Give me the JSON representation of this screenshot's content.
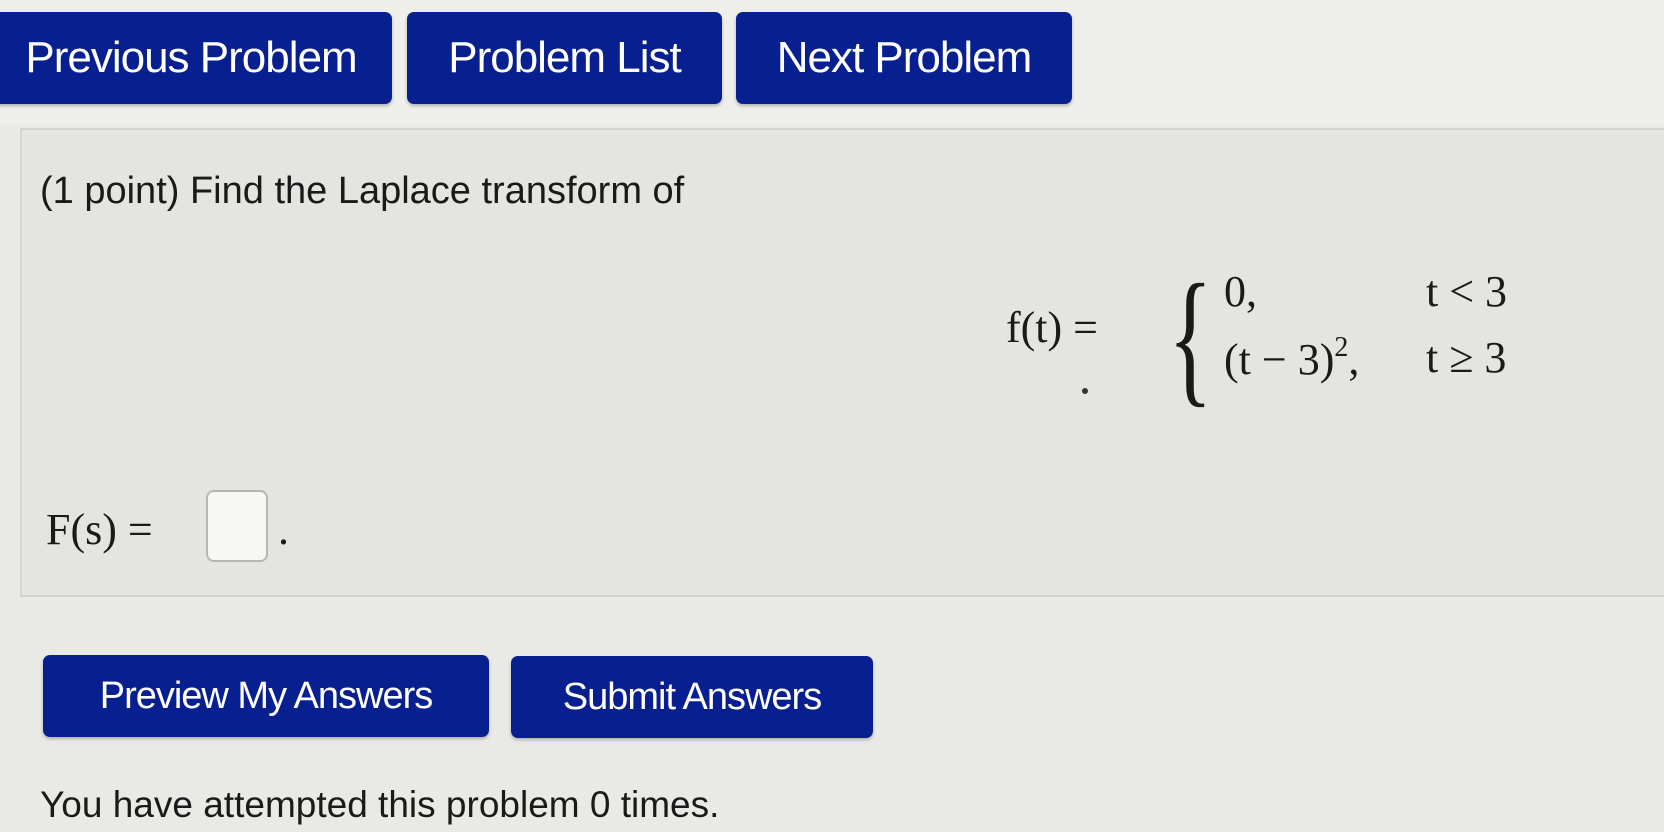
{
  "nav": {
    "previous_label": "Previous Problem",
    "list_label": "Problem List",
    "next_label": "Next Problem"
  },
  "problem": {
    "statement": "(1 point) Find the Laplace transform of",
    "function_lhs": "f(t) =",
    "brace": "{",
    "cases": [
      {
        "value_html": "0,",
        "condition": "t < 3"
      },
      {
        "value_base": "(t − 3)",
        "value_exp": "2",
        "value_tail": ",",
        "condition": "t ≥ 3"
      }
    ],
    "answer_lhs": "F(s) =",
    "answer_value": "",
    "answer_period": "."
  },
  "actions": {
    "preview_label": "Preview My Answers",
    "submit_label": "Submit Answers"
  },
  "status": {
    "attempts_text": "You have attempted this problem 0 times."
  },
  "colors": {
    "button_bg": "#08208f",
    "page_bg": "#e9e9e5",
    "problem_bg": "#e4e4e0"
  }
}
